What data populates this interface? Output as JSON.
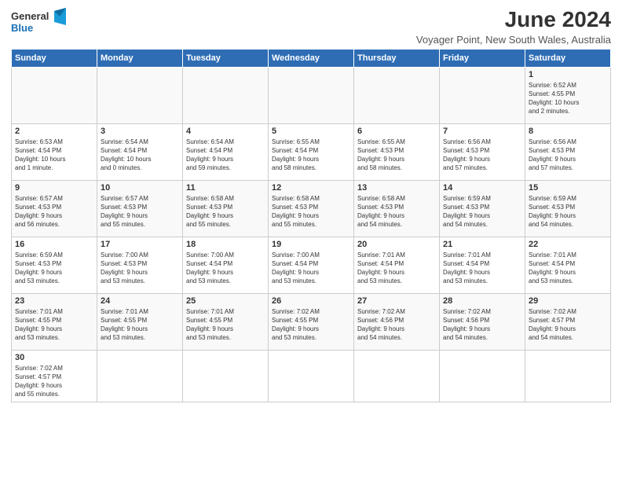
{
  "header": {
    "logo_line1": "General",
    "logo_line2": "Blue",
    "month_title": "June 2024",
    "subtitle": "Voyager Point, New South Wales, Australia"
  },
  "weekdays": [
    "Sunday",
    "Monday",
    "Tuesday",
    "Wednesday",
    "Thursday",
    "Friday",
    "Saturday"
  ],
  "weeks": [
    [
      {
        "day": "",
        "info": ""
      },
      {
        "day": "",
        "info": ""
      },
      {
        "day": "",
        "info": ""
      },
      {
        "day": "",
        "info": ""
      },
      {
        "day": "",
        "info": ""
      },
      {
        "day": "",
        "info": ""
      },
      {
        "day": "1",
        "info": "Sunrise: 6:52 AM\nSunset: 4:55 PM\nDaylight: 10 hours\nand 2 minutes."
      }
    ],
    [
      {
        "day": "2",
        "info": "Sunrise: 6:53 AM\nSunset: 4:54 PM\nDaylight: 10 hours\nand 1 minute."
      },
      {
        "day": "3",
        "info": "Sunrise: 6:54 AM\nSunset: 4:54 PM\nDaylight: 10 hours\nand 0 minutes."
      },
      {
        "day": "4",
        "info": "Sunrise: 6:54 AM\nSunset: 4:54 PM\nDaylight: 9 hours\nand 59 minutes."
      },
      {
        "day": "5",
        "info": "Sunrise: 6:55 AM\nSunset: 4:54 PM\nDaylight: 9 hours\nand 58 minutes."
      },
      {
        "day": "6",
        "info": "Sunrise: 6:55 AM\nSunset: 4:53 PM\nDaylight: 9 hours\nand 58 minutes."
      },
      {
        "day": "7",
        "info": "Sunrise: 6:56 AM\nSunset: 4:53 PM\nDaylight: 9 hours\nand 57 minutes."
      },
      {
        "day": "8",
        "info": "Sunrise: 6:56 AM\nSunset: 4:53 PM\nDaylight: 9 hours\nand 57 minutes."
      }
    ],
    [
      {
        "day": "9",
        "info": "Sunrise: 6:57 AM\nSunset: 4:53 PM\nDaylight: 9 hours\nand 56 minutes."
      },
      {
        "day": "10",
        "info": "Sunrise: 6:57 AM\nSunset: 4:53 PM\nDaylight: 9 hours\nand 55 minutes."
      },
      {
        "day": "11",
        "info": "Sunrise: 6:58 AM\nSunset: 4:53 PM\nDaylight: 9 hours\nand 55 minutes."
      },
      {
        "day": "12",
        "info": "Sunrise: 6:58 AM\nSunset: 4:53 PM\nDaylight: 9 hours\nand 55 minutes."
      },
      {
        "day": "13",
        "info": "Sunrise: 6:58 AM\nSunset: 4:53 PM\nDaylight: 9 hours\nand 54 minutes."
      },
      {
        "day": "14",
        "info": "Sunrise: 6:59 AM\nSunset: 4:53 PM\nDaylight: 9 hours\nand 54 minutes."
      },
      {
        "day": "15",
        "info": "Sunrise: 6:59 AM\nSunset: 4:53 PM\nDaylight: 9 hours\nand 54 minutes."
      }
    ],
    [
      {
        "day": "16",
        "info": "Sunrise: 6:59 AM\nSunset: 4:53 PM\nDaylight: 9 hours\nand 53 minutes."
      },
      {
        "day": "17",
        "info": "Sunrise: 7:00 AM\nSunset: 4:53 PM\nDaylight: 9 hours\nand 53 minutes."
      },
      {
        "day": "18",
        "info": "Sunrise: 7:00 AM\nSunset: 4:54 PM\nDaylight: 9 hours\nand 53 minutes."
      },
      {
        "day": "19",
        "info": "Sunrise: 7:00 AM\nSunset: 4:54 PM\nDaylight: 9 hours\nand 53 minutes."
      },
      {
        "day": "20",
        "info": "Sunrise: 7:01 AM\nSunset: 4:54 PM\nDaylight: 9 hours\nand 53 minutes."
      },
      {
        "day": "21",
        "info": "Sunrise: 7:01 AM\nSunset: 4:54 PM\nDaylight: 9 hours\nand 53 minutes."
      },
      {
        "day": "22",
        "info": "Sunrise: 7:01 AM\nSunset: 4:54 PM\nDaylight: 9 hours\nand 53 minutes."
      }
    ],
    [
      {
        "day": "23",
        "info": "Sunrise: 7:01 AM\nSunset: 4:55 PM\nDaylight: 9 hours\nand 53 minutes."
      },
      {
        "day": "24",
        "info": "Sunrise: 7:01 AM\nSunset: 4:55 PM\nDaylight: 9 hours\nand 53 minutes."
      },
      {
        "day": "25",
        "info": "Sunrise: 7:01 AM\nSunset: 4:55 PM\nDaylight: 9 hours\nand 53 minutes."
      },
      {
        "day": "26",
        "info": "Sunrise: 7:02 AM\nSunset: 4:55 PM\nDaylight: 9 hours\nand 53 minutes."
      },
      {
        "day": "27",
        "info": "Sunrise: 7:02 AM\nSunset: 4:56 PM\nDaylight: 9 hours\nand 54 minutes."
      },
      {
        "day": "28",
        "info": "Sunrise: 7:02 AM\nSunset: 4:56 PM\nDaylight: 9 hours\nand 54 minutes."
      },
      {
        "day": "29",
        "info": "Sunrise: 7:02 AM\nSunset: 4:57 PM\nDaylight: 9 hours\nand 54 minutes."
      }
    ],
    [
      {
        "day": "30",
        "info": "Sunrise: 7:02 AM\nSunset: 4:57 PM\nDaylight: 9 hours\nand 55 minutes."
      },
      {
        "day": "",
        "info": ""
      },
      {
        "day": "",
        "info": ""
      },
      {
        "day": "",
        "info": ""
      },
      {
        "day": "",
        "info": ""
      },
      {
        "day": "",
        "info": ""
      },
      {
        "day": "",
        "info": ""
      }
    ]
  ]
}
